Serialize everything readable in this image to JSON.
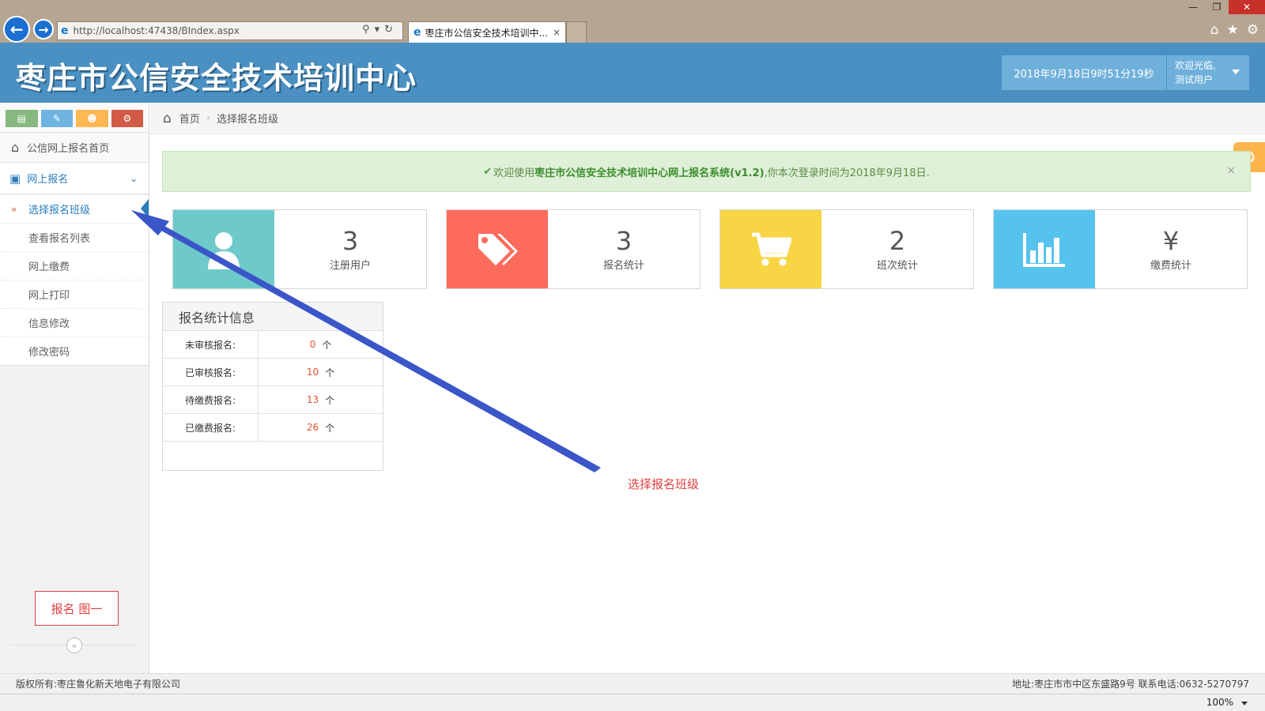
{
  "browser": {
    "url": "http://localhost:47438/BIndex.aspx",
    "tab_title": "枣庄市公信安全技术培训中...",
    "tab_close": "×",
    "zoom": "100%"
  },
  "header": {
    "site_title": "枣庄市公信安全技术培训中心",
    "datetime": "2018年9月18日9时51分19秒",
    "welcome": "欢迎光临,",
    "username": "测试用户"
  },
  "sidebar": {
    "home_label": "公信网上报名首页",
    "group_label": "网上报名",
    "items": [
      {
        "label": "选择报名班级",
        "active": true
      },
      {
        "label": "查看报名列表"
      },
      {
        "label": "网上缴费"
      },
      {
        "label": "网上打印"
      },
      {
        "label": "信息修改"
      },
      {
        "label": "修改密码"
      }
    ],
    "note": "报名  图一",
    "collapse": "«"
  },
  "breadcrumb": {
    "home": "首页",
    "current": "选择报名班级"
  },
  "alert": {
    "prefix": "欢迎使用",
    "brand": "枣庄市公信安全技术培训中心网上报名系统(v1.2)",
    "suffix": ",你本次登录时间为2018年9月18日.",
    "close": "×"
  },
  "cards": [
    {
      "value": "3",
      "label": "注册用户",
      "color": "#6ecaca",
      "icon": "user-icon"
    },
    {
      "value": "3",
      "label": "报名统计",
      "color": "#fd6b5d",
      "icon": "tags-icon"
    },
    {
      "value": "2",
      "label": "班次统计",
      "color": "#f7d545",
      "icon": "cart-icon"
    },
    {
      "value": "¥",
      "label": "缴费统计",
      "color": "#56c3ef",
      "icon": "bar-chart-icon"
    }
  ],
  "stats_panel": {
    "title": "报名统计信息",
    "unit": "个",
    "rows": [
      {
        "label": "未审核报名:",
        "value": "0"
      },
      {
        "label": "已审核报名:",
        "value": "10"
      },
      {
        "label": "待缴费报名:",
        "value": "13"
      },
      {
        "label": "已缴费报名:",
        "value": "26"
      }
    ]
  },
  "annotation": {
    "label": "选择报名班级"
  },
  "footer": {
    "copyright": "版权所有:枣庄鲁化新天地电子有限公司",
    "contact": "地址:枣庄市市中区东盛路9号 联系电话:0632-5270797"
  }
}
